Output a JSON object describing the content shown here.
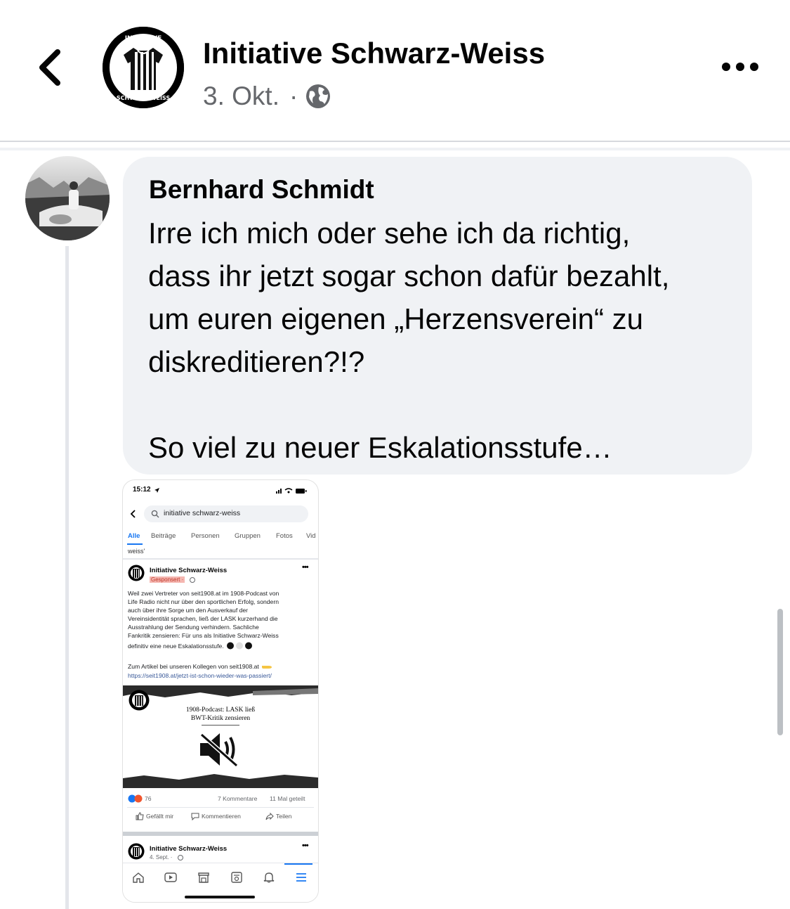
{
  "header": {
    "page_name": "Initiative Schwarz-Weiss",
    "date": "3. Okt.",
    "separator": "·",
    "logo_text_top": "INITIATIVE",
    "logo_text_bottom": "SCHWARZ-WEISS"
  },
  "comment": {
    "author": "Bernhard Schmidt",
    "text": "Irre ich mich oder sehe ich da richtig,\ndass ihr jetzt sogar schon dafür bezahlt,\num euren eigenen „Herzensverein“ zu\ndiskreditieren?!?\n\nSo viel zu neuer Eskalationsstufe…"
  },
  "screenshot": {
    "time": "15:12",
    "search_query": "initiative schwarz-weiss",
    "tabs": [
      "Alle",
      "Beiträge",
      "Personen",
      "Gruppen",
      "Fotos",
      "Vid"
    ],
    "weiss_label": "weiss'",
    "post": {
      "page_name": "Initiative Schwarz-Weiss",
      "sponsored": "Gesponsert ·",
      "lines": [
        "Weil zwei Vertreter von seit1908.at im 1908-Podcast von",
        "Life Radio nicht nur über den sportlichen Erfolg, sondern",
        "auch über ihre Sorge um den Ausverkauf der",
        "Vereinsidentität sprachen, ließ der LASK kurzerhand die",
        "Ausstrahlung der Sendung verhindern. Sachliche",
        "Fankritik zensieren: Für uns als Initiative Schwarz-Weiss",
        "definitiv eine neue Eskalationsstufe."
      ],
      "article_line": "Zum Artikel bei unseren Kollegen von seit1908.at",
      "url": "https://seit1908.at/jetzt-ist-schon-wieder-was-passiert/",
      "image_title_1": "1908-Podcast: LASK ließ",
      "image_title_2": "BWT-Kritik zensieren",
      "reactions_count": "76",
      "comments": "7 Kommentare",
      "shares": "11 Mal geteilt",
      "like": "Gefällt mir",
      "comment": "Kommentieren",
      "share": "Teilen"
    },
    "next_post": {
      "page_name": "Initiative Schwarz-Weiss",
      "date": "4. Sept. ·"
    }
  }
}
